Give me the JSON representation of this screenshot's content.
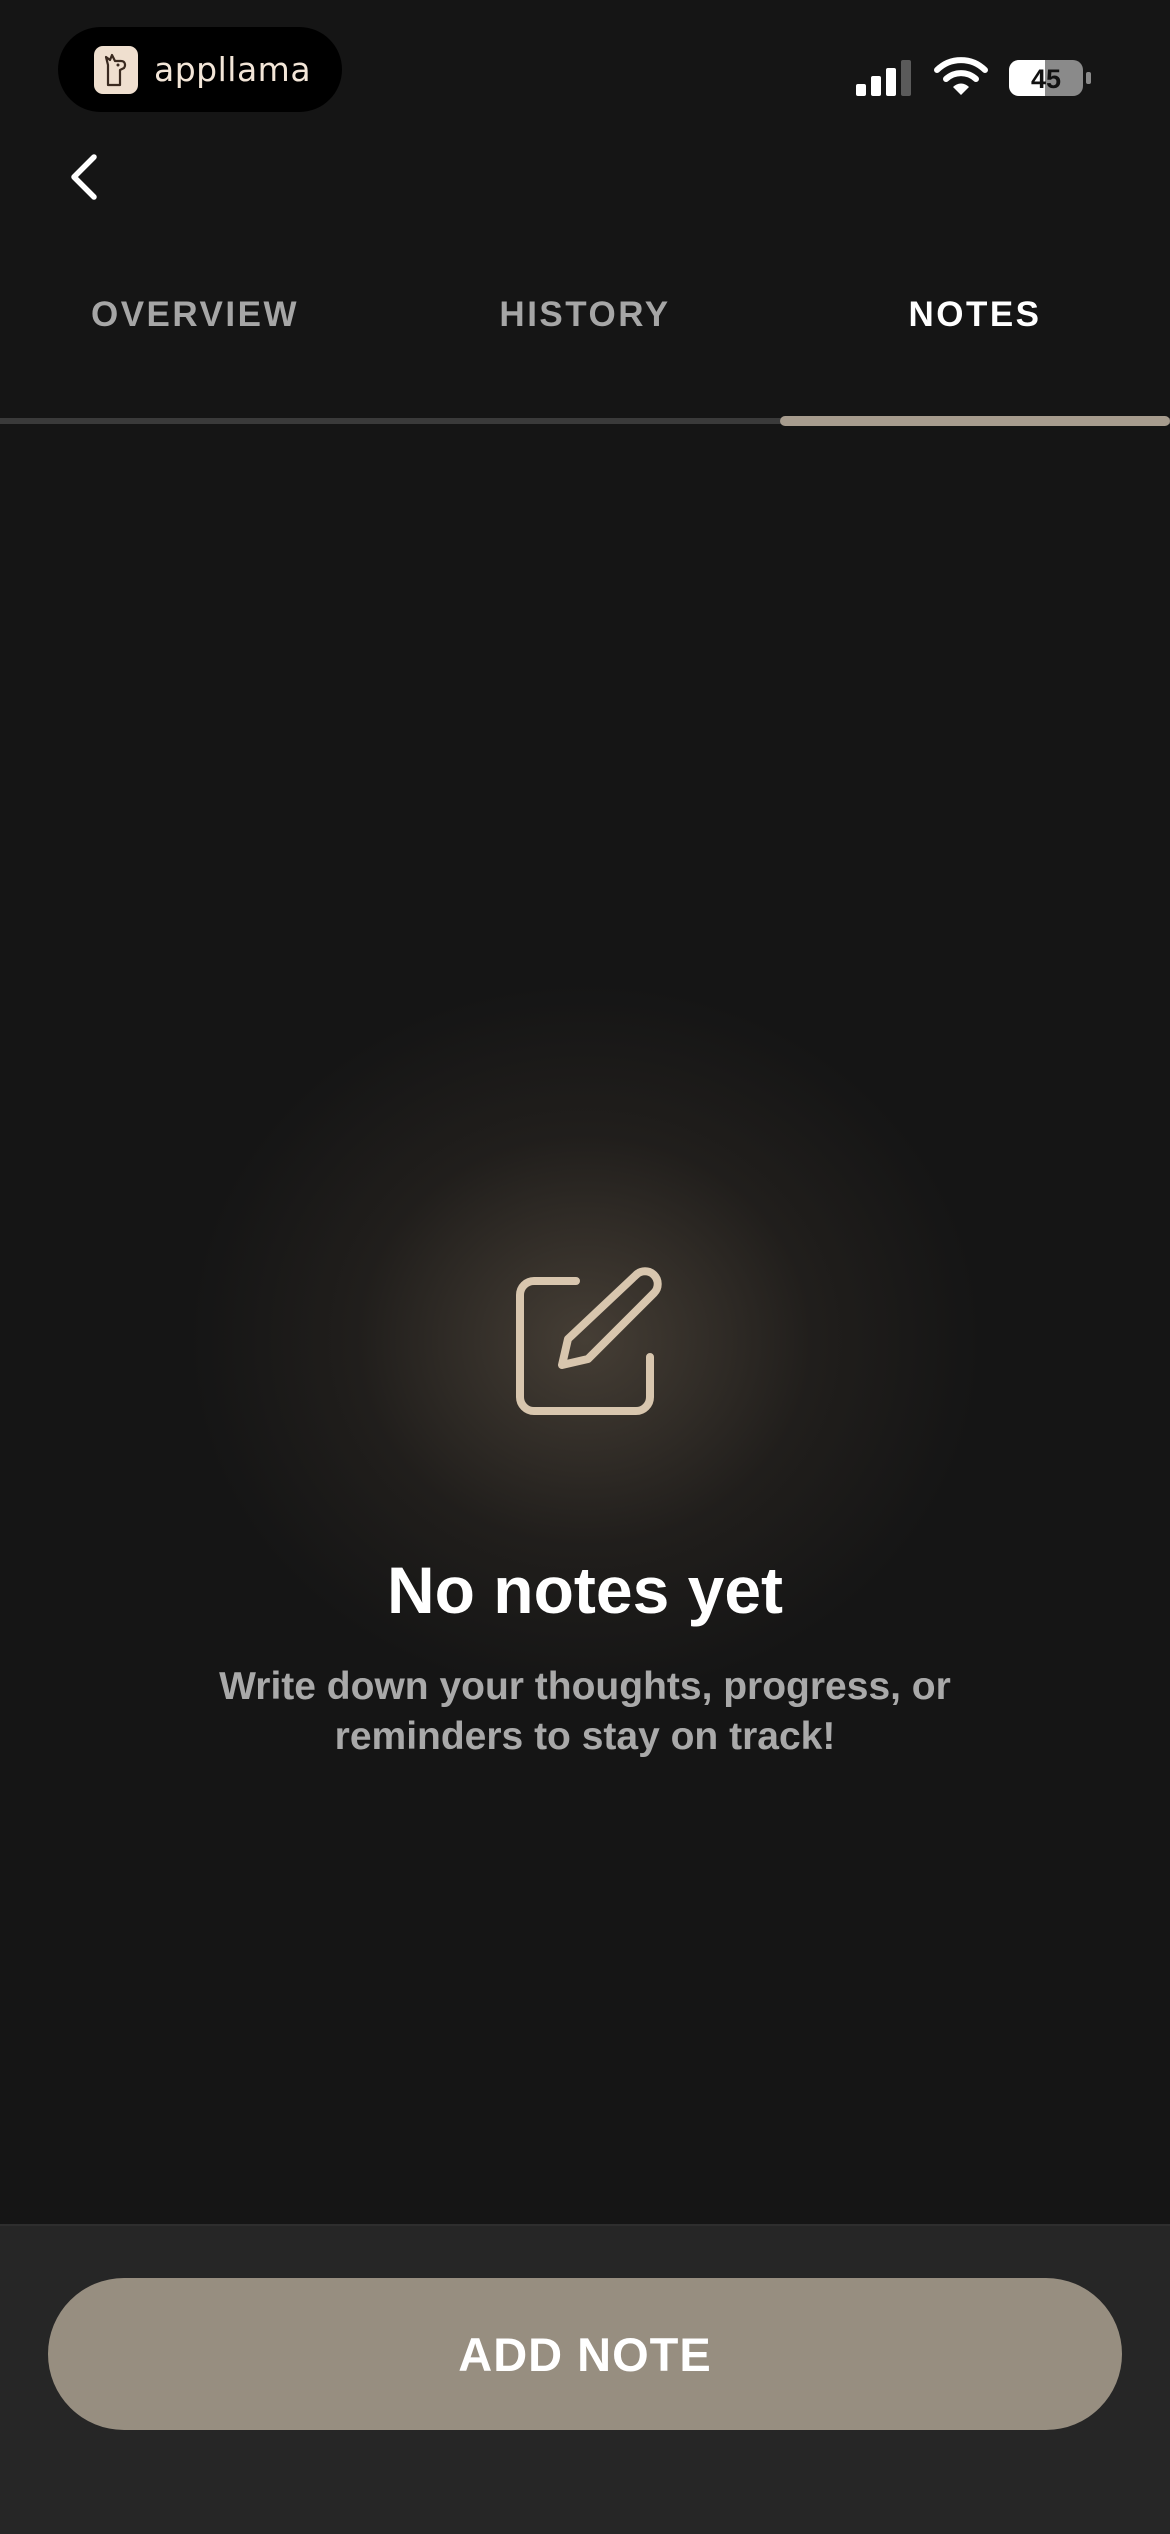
{
  "status_bar": {
    "app_name": "appllama",
    "battery": "45",
    "icons": [
      "appllama-logo-icon",
      "signal-icon",
      "wifi-icon",
      "battery-icon"
    ]
  },
  "nav": {
    "back_icon": "chevron-left-icon"
  },
  "tabs": [
    {
      "label": "OVERVIEW",
      "active": false
    },
    {
      "label": "HISTORY",
      "active": false
    },
    {
      "label": "NOTES",
      "active": true
    }
  ],
  "empty_state": {
    "icon": "edit-note-icon",
    "title": "No notes yet",
    "subtitle_line1": "Write down your thoughts, progress, or",
    "subtitle_line2": "reminders to stay on track!"
  },
  "actions": {
    "add_note_label": "ADD NOTE"
  },
  "colors": {
    "background": "#151515",
    "accent": "#978e80",
    "tab_indicator": "#a79c8e",
    "icon_tint": "#d8c6ae"
  }
}
